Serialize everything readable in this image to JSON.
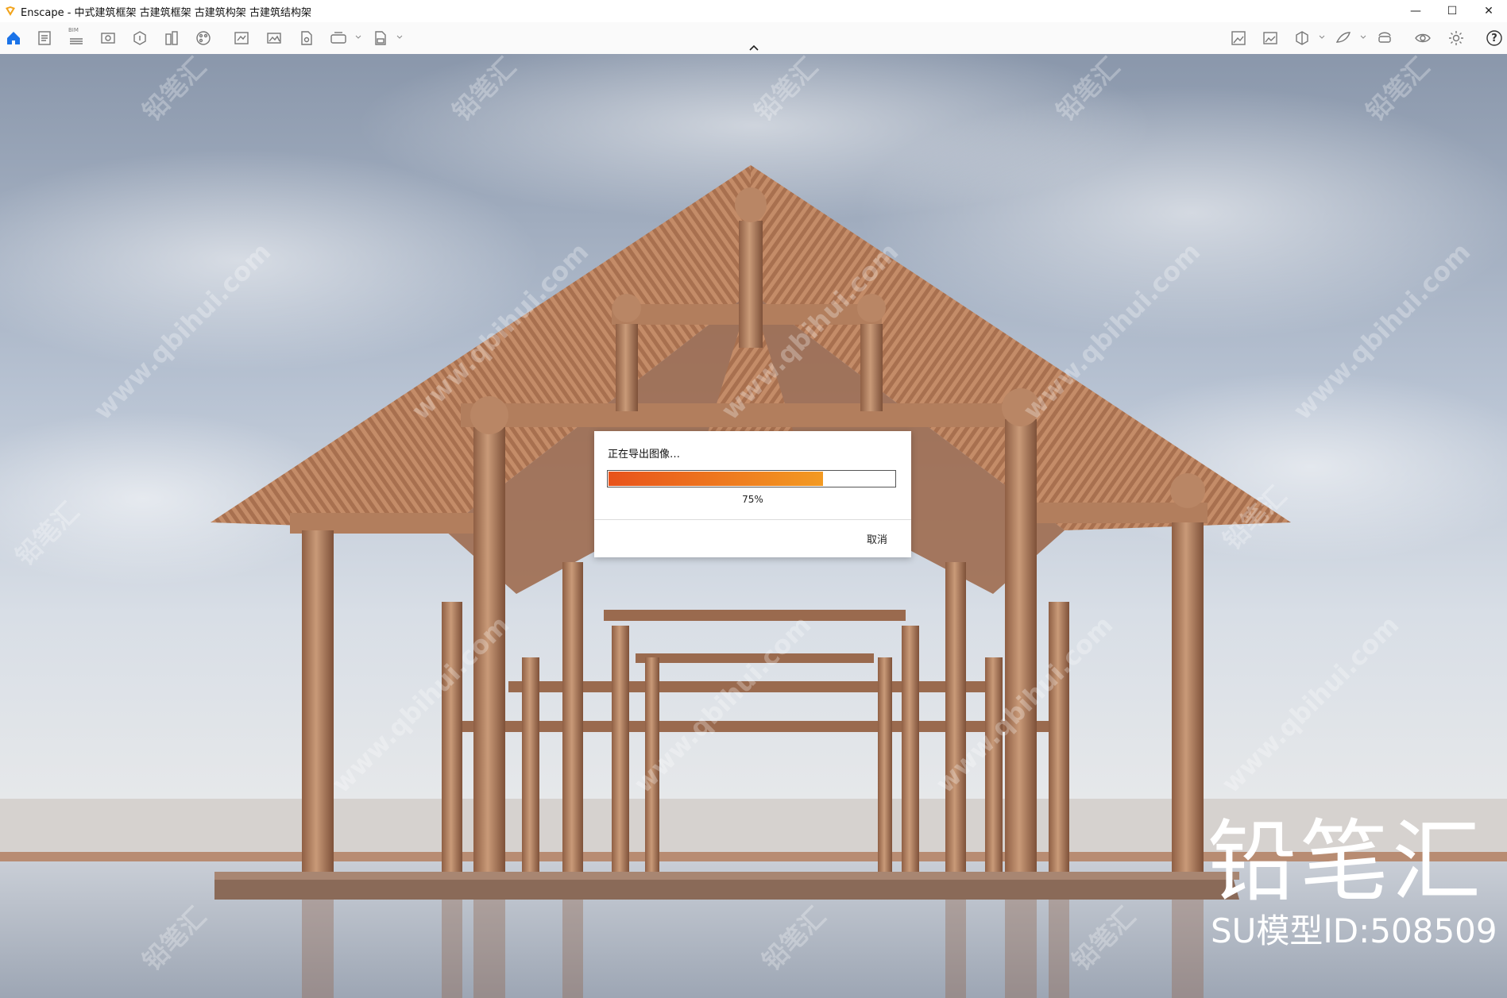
{
  "window": {
    "title": "Enscape - 中式建筑框架 古建筑框架 古建筑构架  古建筑结构架",
    "minimize_glyph": "—",
    "maximize_glyph": "☐",
    "close_glyph": "✕"
  },
  "toolbar": {
    "left_icons": [
      "home-icon",
      "notes-icon",
      "bim-icon",
      "views-icon",
      "asset-library-icon",
      "site-context-icon",
      "material-editor-icon",
      "sun-settings-icon",
      "batch-render-icon",
      "screenshot-icon",
      "panorama-icon",
      "video-editor-icon",
      "export-exe-icon"
    ],
    "right_icons": [
      "image-capture-icon",
      "gallery-icon",
      "cube-view-icon",
      "fly-mode-icon",
      "vr-headset-icon",
      "visual-settings-icon",
      "general-settings-icon",
      "help-icon"
    ],
    "bim_label": "BIM",
    "help_label": "?"
  },
  "dialog": {
    "title": "正在导出图像…",
    "progress": 0.75,
    "progress_label": "75%",
    "cancel_label": "取消"
  },
  "watermark": {
    "site": "www.qbihui.com",
    "cn": "铅笔汇",
    "brand": "铅笔汇",
    "model_id": "SU模型ID:508509"
  },
  "colors": {
    "accent": "#1a73e8",
    "progress_start": "#e8531b",
    "progress_end": "#f39a22",
    "wood": "#b98665"
  }
}
